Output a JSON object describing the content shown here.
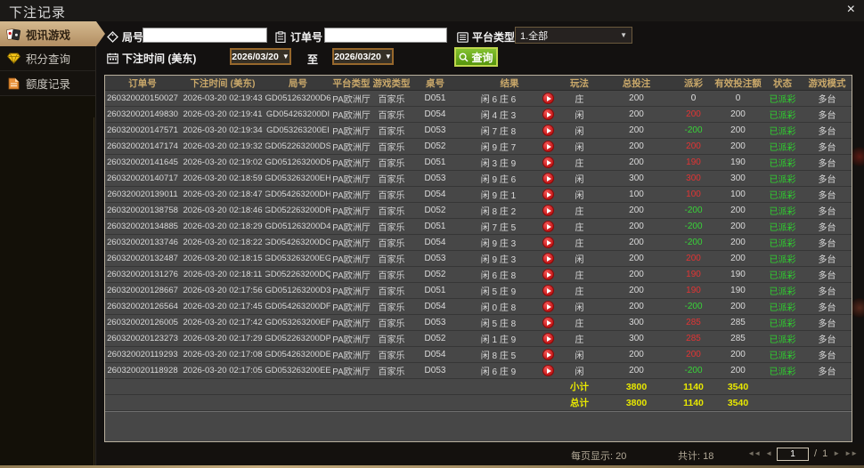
{
  "window": {
    "title": "下注记录"
  },
  "icons": {
    "close": "×",
    "caret_down": "▼",
    "pager_first": "◄◄",
    "pager_prev": "◄",
    "pager_next": "►",
    "pager_last": "►►"
  },
  "colors": {
    "accent_tan": "#c3a378",
    "header_gold": "#c9a86a",
    "win_red": "#e23434",
    "lose_green": "#38d438",
    "status_green": "#2ed32e",
    "summary_yellow": "#e8e800",
    "search_button_green": "#6aab17"
  },
  "sidebar": {
    "items": [
      {
        "label": "视讯游戏",
        "active": true
      },
      {
        "label": "积分查询",
        "active": false
      },
      {
        "label": "额度记录",
        "active": false
      }
    ]
  },
  "filters": {
    "round_label": "局号",
    "order_label": "订单号",
    "platform_label": "平台类型",
    "platform_value": "1.全部",
    "time_label": "下注时间 (美东)",
    "date_from": "2026/03/20",
    "to_label": "至",
    "date_to": "2026/03/20",
    "search_label": "查询"
  },
  "table": {
    "headers": [
      "订单号",
      "下注时间 (美东)",
      "局号",
      "平台类型",
      "游戏类型",
      "桌号",
      "结果",
      "玩法",
      "总投注",
      "派彩",
      "有效投注额",
      "状态",
      "游戏模式"
    ],
    "rows": [
      {
        "order": "260320020150027",
        "time": "2026-03-20 02:19:43",
        "round": "GD051263200D6",
        "platform": "PA欧洲厅",
        "game": "百家乐",
        "table": "D051",
        "result": "闲 6 庄 6",
        "bet_on": "庄",
        "bet": "200",
        "payout": "0",
        "payout_color": "zero",
        "valid": "0",
        "status": "已派彩",
        "mode": "多台"
      },
      {
        "order": "260320020149830",
        "time": "2026-03-20 02:19:41",
        "round": "GD054263200DI",
        "platform": "PA欧洲厅",
        "game": "百家乐",
        "table": "D054",
        "result": "闲 4 庄 3",
        "bet_on": "闲",
        "bet": "200",
        "payout": "200",
        "payout_color": "win",
        "valid": "200",
        "status": "已派彩",
        "mode": "多台"
      },
      {
        "order": "260320020147571",
        "time": "2026-03-20 02:19:34",
        "round": "GD053263200EI",
        "platform": "PA欧洲厅",
        "game": "百家乐",
        "table": "D053",
        "result": "闲 7 庄 8",
        "bet_on": "闲",
        "bet": "200",
        "payout": "-200",
        "payout_color": "lose",
        "valid": "200",
        "status": "已派彩",
        "mode": "多台"
      },
      {
        "order": "260320020147174",
        "time": "2026-03-20 02:19:32",
        "round": "GD052263200DS",
        "platform": "PA欧洲厅",
        "game": "百家乐",
        "table": "D052",
        "result": "闲 9 庄 7",
        "bet_on": "闲",
        "bet": "200",
        "payout": "200",
        "payout_color": "win",
        "valid": "200",
        "status": "已派彩",
        "mode": "多台"
      },
      {
        "order": "260320020141645",
        "time": "2026-03-20 02:19:02",
        "round": "GD051263200D5",
        "platform": "PA欧洲厅",
        "game": "百家乐",
        "table": "D051",
        "result": "闲 3 庄 9",
        "bet_on": "庄",
        "bet": "200",
        "payout": "190",
        "payout_color": "win",
        "valid": "190",
        "status": "已派彩",
        "mode": "多台"
      },
      {
        "order": "260320020140717",
        "time": "2026-03-20 02:18:59",
        "round": "GD053263200EH",
        "platform": "PA欧洲厅",
        "game": "百家乐",
        "table": "D053",
        "result": "闲 9 庄 6",
        "bet_on": "闲",
        "bet": "300",
        "payout": "300",
        "payout_color": "win",
        "valid": "300",
        "status": "已派彩",
        "mode": "多台"
      },
      {
        "order": "260320020139011",
        "time": "2026-03-20 02:18:47",
        "round": "GD054263200DH",
        "platform": "PA欧洲厅",
        "game": "百家乐",
        "table": "D054",
        "result": "闲 9 庄 1",
        "bet_on": "闲",
        "bet": "100",
        "payout": "100",
        "payout_color": "win",
        "valid": "100",
        "status": "已派彩",
        "mode": "多台"
      },
      {
        "order": "260320020138758",
        "time": "2026-03-20 02:18:46",
        "round": "GD052263200DR",
        "platform": "PA欧洲厅",
        "game": "百家乐",
        "table": "D052",
        "result": "闲 8 庄 2",
        "bet_on": "庄",
        "bet": "200",
        "payout": "-200",
        "payout_color": "lose",
        "valid": "200",
        "status": "已派彩",
        "mode": "多台"
      },
      {
        "order": "260320020134885",
        "time": "2026-03-20 02:18:29",
        "round": "GD051263200D4",
        "platform": "PA欧洲厅",
        "game": "百家乐",
        "table": "D051",
        "result": "闲 7 庄 5",
        "bet_on": "庄",
        "bet": "200",
        "payout": "-200",
        "payout_color": "lose",
        "valid": "200",
        "status": "已派彩",
        "mode": "多台"
      },
      {
        "order": "260320020133746",
        "time": "2026-03-20 02:18:22",
        "round": "GD054263200DG",
        "platform": "PA欧洲厅",
        "game": "百家乐",
        "table": "D054",
        "result": "闲 9 庄 3",
        "bet_on": "庄",
        "bet": "200",
        "payout": "-200",
        "payout_color": "lose",
        "valid": "200",
        "status": "已派彩",
        "mode": "多台"
      },
      {
        "order": "260320020132487",
        "time": "2026-03-20 02:18:15",
        "round": "GD053263200EG",
        "platform": "PA欧洲厅",
        "game": "百家乐",
        "table": "D053",
        "result": "闲 9 庄 3",
        "bet_on": "闲",
        "bet": "200",
        "payout": "200",
        "payout_color": "win",
        "valid": "200",
        "status": "已派彩",
        "mode": "多台"
      },
      {
        "order": "260320020131276",
        "time": "2026-03-20 02:18:11",
        "round": "GD052263200DQ",
        "platform": "PA欧洲厅",
        "game": "百家乐",
        "table": "D052",
        "result": "闲 6 庄 8",
        "bet_on": "庄",
        "bet": "200",
        "payout": "190",
        "payout_color": "win",
        "valid": "190",
        "status": "已派彩",
        "mode": "多台"
      },
      {
        "order": "260320020128667",
        "time": "2026-03-20 02:17:56",
        "round": "GD051263200D3",
        "platform": "PA欧洲厅",
        "game": "百家乐",
        "table": "D051",
        "result": "闲 5 庄 9",
        "bet_on": "庄",
        "bet": "200",
        "payout": "190",
        "payout_color": "win",
        "valid": "190",
        "status": "已派彩",
        "mode": "多台"
      },
      {
        "order": "260320020126564",
        "time": "2026-03-20 02:17:45",
        "round": "GD054263200DF",
        "platform": "PA欧洲厅",
        "game": "百家乐",
        "table": "D054",
        "result": "闲 0 庄 8",
        "bet_on": "闲",
        "bet": "200",
        "payout": "-200",
        "payout_color": "lose",
        "valid": "200",
        "status": "已派彩",
        "mode": "多台"
      },
      {
        "order": "260320020126005",
        "time": "2026-03-20 02:17:42",
        "round": "GD053263200EF",
        "platform": "PA欧洲厅",
        "game": "百家乐",
        "table": "D053",
        "result": "闲 5 庄 8",
        "bet_on": "庄",
        "bet": "300",
        "payout": "285",
        "payout_color": "win",
        "valid": "285",
        "status": "已派彩",
        "mode": "多台"
      },
      {
        "order": "260320020123273",
        "time": "2026-03-20 02:17:29",
        "round": "GD052263200DP",
        "platform": "PA欧洲厅",
        "game": "百家乐",
        "table": "D052",
        "result": "闲 1 庄 9",
        "bet_on": "庄",
        "bet": "300",
        "payout": "285",
        "payout_color": "win",
        "valid": "285",
        "status": "已派彩",
        "mode": "多台"
      },
      {
        "order": "260320020119293",
        "time": "2026-03-20 02:17:08",
        "round": "GD054263200DE",
        "platform": "PA欧洲厅",
        "game": "百家乐",
        "table": "D054",
        "result": "闲 8 庄 5",
        "bet_on": "闲",
        "bet": "200",
        "payout": "200",
        "payout_color": "win",
        "valid": "200",
        "status": "已派彩",
        "mode": "多台"
      },
      {
        "order": "260320020118928",
        "time": "2026-03-20 02:17:05",
        "round": "GD053263200EE",
        "platform": "PA欧洲厅",
        "game": "百家乐",
        "table": "D053",
        "result": "闲 6 庄 9",
        "bet_on": "闲",
        "bet": "200",
        "payout": "-200",
        "payout_color": "lose",
        "valid": "200",
        "status": "已派彩",
        "mode": "多台"
      }
    ],
    "subtotal": {
      "label": "小计",
      "bet": "3800",
      "payout": "1140",
      "valid": "3540"
    },
    "total": {
      "label": "总计",
      "bet": "3800",
      "payout": "1140",
      "valid": "3540"
    }
  },
  "footer": {
    "per_page_label": "每页显示:",
    "per_page": "20",
    "count_label": "共计:",
    "count": "18",
    "page": "1",
    "page_sep": "/",
    "page_count": "1"
  }
}
